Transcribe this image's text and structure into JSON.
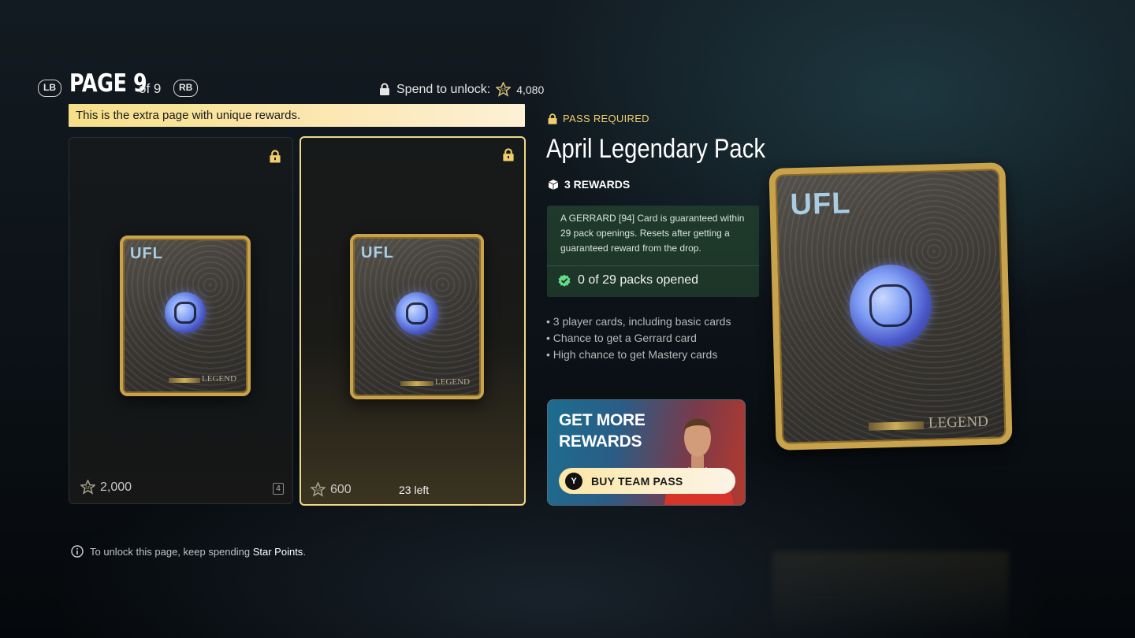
{
  "header": {
    "left_bumper": "LB",
    "right_bumper": "RB",
    "page_label": "PAGE 9",
    "page_of": "of 9",
    "spend_label": "Spend to unlock:",
    "spend_amount": "4,080"
  },
  "banner": {
    "text": "This is the extra page with unique rewards."
  },
  "packs": [
    {
      "logo": "UFL",
      "brand": "LEGEND",
      "price": "2,000",
      "badge": "4",
      "left": ""
    },
    {
      "logo": "UFL",
      "brand": "LEGEND",
      "price": "600",
      "badge": "",
      "left": "23 left"
    }
  ],
  "detail": {
    "pass_required": "PASS REQUIRED",
    "title": "April Legendary Pack",
    "rewards_count": "3 REWARDS",
    "guarantee": "A GERRARD [94] Card is guaranteed within 29 pack openings. Resets after getting a guaranteed reward from the drop.",
    "progress": "0 of 29 packs opened",
    "bullets": [
      "• 3 player cards, including basic cards",
      "• Chance to get a Gerrard card",
      "• High chance to get Mastery cards"
    ]
  },
  "promo": {
    "line1": "GET MORE",
    "line2": "REWARDS",
    "button_key": "Y",
    "button_label": "BUY TEAM PASS"
  },
  "big_pack": {
    "logo": "UFL",
    "brand": "LEGEND"
  },
  "footer": {
    "note_prefix": "To unlock this page, keep spending",
    "note_link": "Star Points",
    "note_suffix": "."
  },
  "colors": {
    "accent_gold": "#f1d98a",
    "pass_gold": "#f0cf6b",
    "guarantee_green": "#1f3a2c"
  }
}
